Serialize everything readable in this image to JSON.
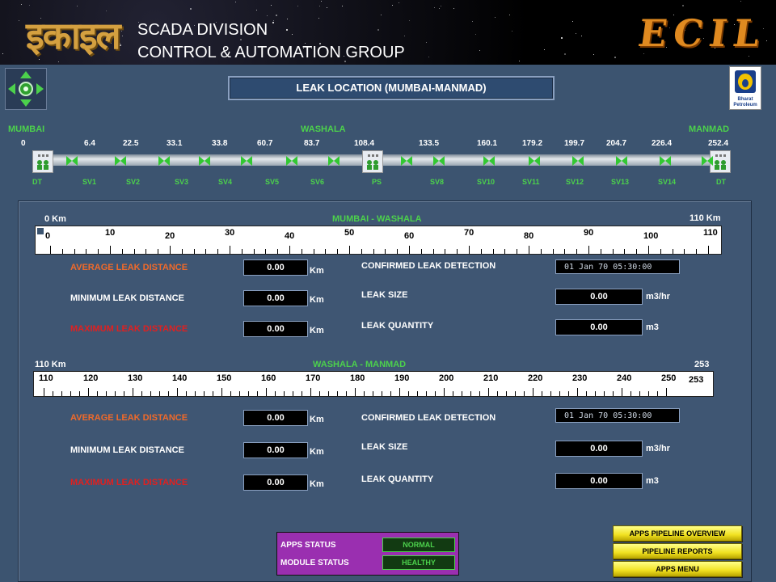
{
  "header": {
    "logo_text": "इकाइल",
    "line1": "SCADA DIVISION",
    "line2": "CONTROL & AUTOMATION GROUP",
    "brand": "ECIL"
  },
  "title": "LEAK LOCATION (MUMBAI-MANMAD)",
  "bp_logo": {
    "line1": "Bharat",
    "line2": "Petroleum"
  },
  "pipeline": {
    "start": "MUMBAI",
    "middle": "WASHALA",
    "end": "MANMAD",
    "distances": [
      "0",
      "6.4",
      "22.5",
      "33.1",
      "33.8",
      "60.7",
      "83.7",
      "108.4",
      "133.5",
      "160.1",
      "179.2",
      "199.7",
      "204.7",
      "226.4",
      "252.4"
    ],
    "stations": [
      "DT",
      "SV1",
      "SV2",
      "SV3",
      "SV4",
      "SV5",
      "SV6",
      "PS",
      "SV8",
      "SV10",
      "SV11",
      "SV12",
      "SV13",
      "SV14",
      "DT"
    ]
  },
  "section1": {
    "left": "0 Km",
    "title": "MUMBAI - WASHALA",
    "right": "110 Km",
    "ticks": [
      "0",
      "10",
      "20",
      "30",
      "40",
      "50",
      "60",
      "70",
      "80",
      "90",
      "100",
      "110"
    ],
    "avg_label": "AVERAGE LEAK DISTANCE",
    "min_label": "MINIMUM LEAK DISTANCE",
    "max_label": "MAXIMUM LEAK DISTANCE",
    "avg": "0.00",
    "min": "0.00",
    "max": "0.00",
    "unit_km": "Km",
    "confirmed_label": "CONFIRMED LEAK DETECTION",
    "confirmed": "01 Jan 70  05:30:00",
    "size_label": "LEAK SIZE",
    "size": "0.00",
    "size_unit": "m3/hr",
    "qty_label": "LEAK QUANTITY",
    "qty": "0.00",
    "qty_unit": "m3"
  },
  "section2": {
    "left": "110 Km",
    "title": "WASHALA - MANMAD",
    "right": "253",
    "ticks": [
      "110",
      "120",
      "130",
      "140",
      "150",
      "160",
      "170",
      "180",
      "190",
      "200",
      "210",
      "220",
      "230",
      "240",
      "250"
    ],
    "end_tick": "253",
    "avg_label": "AVERAGE LEAK DISTANCE",
    "min_label": "MINIMUM LEAK DISTANCE",
    "max_label": "MAXIMUM LEAK DISTANCE",
    "avg": "0.00",
    "min": "0.00",
    "max": "0.00",
    "unit_km": "Km",
    "confirmed_label": "CONFIRMED LEAK DETECTION",
    "confirmed": "01 Jan 70  05:30:00",
    "size_label": "LEAK SIZE",
    "size": "0.00",
    "size_unit": "m3/hr",
    "qty_label": "LEAK QUANTITY",
    "qty": "0.00",
    "qty_unit": "m3"
  },
  "status": {
    "apps_label": "APPS STATUS",
    "apps_value": "NORMAL",
    "module_label": "MODULE STATUS",
    "module_value": "HEALTHY"
  },
  "buttons": {
    "overview": "APPS PIPELINE OVERVIEW",
    "reports": "PIPELINE REPORTS",
    "menu": "APPS MENU"
  }
}
